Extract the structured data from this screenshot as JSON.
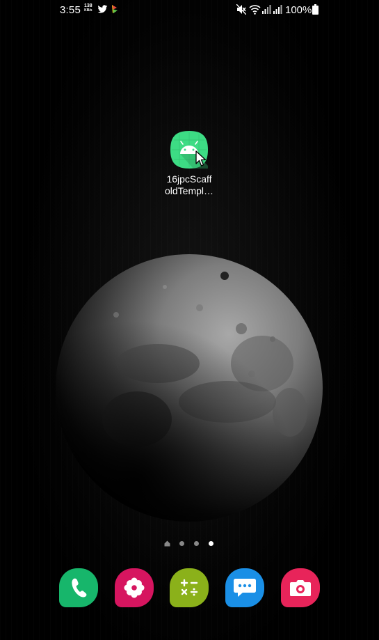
{
  "status_bar": {
    "time": "3:55",
    "net_speed_value": "138",
    "net_speed_unit": "KB/s",
    "battery": "100%",
    "icons": [
      "twitter-icon",
      "app-notification-icon",
      "mute-icon",
      "wifi-icon",
      "signal-icon",
      "signal-icon",
      "battery-icon"
    ]
  },
  "home": {
    "app": {
      "label": "16jpcScaffoldTempl…",
      "label_line1": "16jpcScaff",
      "label_line2": "oldTempl…",
      "icon": "android-icon",
      "color": "#3ddc84"
    }
  },
  "page_indicator": {
    "pages": 3,
    "active_index": 2
  },
  "dock": {
    "apps": [
      {
        "name": "phone",
        "icon": "phone-icon",
        "color": "#17b66b"
      },
      {
        "name": "gallery",
        "icon": "flower-icon",
        "color": "#d6155f"
      },
      {
        "name": "calculator",
        "icon": "calculator-icon",
        "color": "#8bb11a"
      },
      {
        "name": "messages",
        "icon": "chat-icon",
        "color": "#1a8fe6"
      },
      {
        "name": "camera",
        "icon": "camera-icon",
        "color": "#e8245a"
      }
    ]
  }
}
